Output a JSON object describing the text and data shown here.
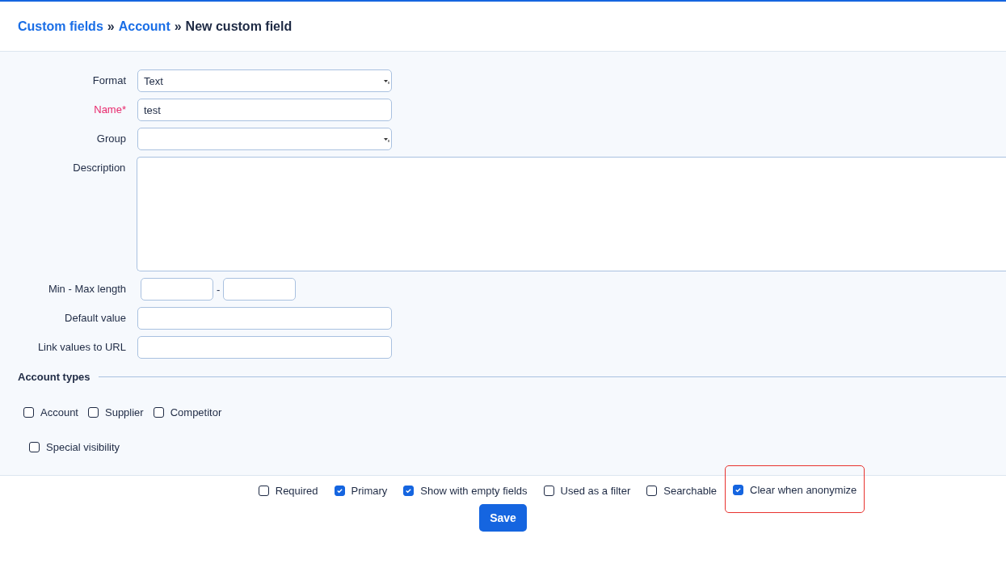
{
  "breadcrumb_separator": "»",
  "breadcrumb": [
    {
      "text": "Custom fields",
      "kind": "link"
    },
    {
      "text": "Account",
      "kind": "link"
    },
    {
      "text": "New custom field",
      "kind": "current"
    }
  ],
  "form": {
    "fields": [
      {
        "label": "Format",
        "kind": "select",
        "value": "Text",
        "required": false
      },
      {
        "label": "Name*",
        "kind": "input",
        "value": "test",
        "required": true
      },
      {
        "label": "Group",
        "kind": "select",
        "required": false
      },
      {
        "label": "Description",
        "kind": "textarea",
        "required": false
      },
      {
        "label": "Min - Max length",
        "kind": "range",
        "separator": "-",
        "required": false
      },
      {
        "label": "Default value",
        "kind": "input",
        "required": false
      },
      {
        "label": "Link values to URL",
        "kind": "input",
        "required": false
      }
    ]
  },
  "account_types": {
    "title": "Account types",
    "options": [
      {
        "label": "Account",
        "checked": false
      },
      {
        "label": "Supplier",
        "checked": false
      },
      {
        "label": "Competitor",
        "checked": false
      }
    ],
    "special_visibility": {
      "label": "Special visibility",
      "checked": false
    }
  },
  "options": [
    {
      "label": "Required",
      "checked": false,
      "highlighted": false
    },
    {
      "label": "Primary",
      "checked": true,
      "highlighted": false
    },
    {
      "label": "Show with empty fields",
      "checked": true,
      "highlighted": false
    },
    {
      "label": "Used as a filter",
      "checked": false,
      "highlighted": false
    },
    {
      "label": "Searchable",
      "checked": false,
      "highlighted": false
    },
    {
      "label": "Clear when anonymize",
      "checked": true,
      "highlighted": true
    }
  ],
  "save_button": "Save"
}
